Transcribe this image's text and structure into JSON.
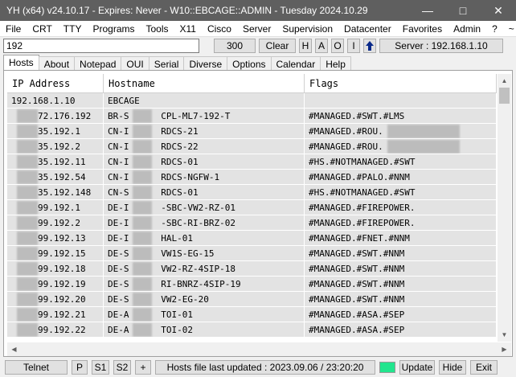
{
  "window": {
    "title": "YH (x64) v24.10.17 - Expires: Never - W10::EBCAGE::ADMIN - Tuesday 2024.10.29",
    "minimize": "—",
    "maximize": "□",
    "close": "✕"
  },
  "menu": [
    "File",
    "CRT",
    "TTY",
    "Programs",
    "Tools",
    "X11",
    "Cisco",
    "Server",
    "Supervision",
    "Datacenter",
    "Favorites",
    "Admin",
    "?",
    "~"
  ],
  "toolbar": {
    "search_value": "192",
    "count_value": "300",
    "clear": "Clear",
    "h": "H",
    "a": "A",
    "o": "O",
    "i": "I",
    "up_arrow": "🡅",
    "server": "Server : 192.168.1.10"
  },
  "tabs": [
    "Hosts",
    "About",
    "Notepad",
    "OUI",
    "Serial",
    "Diverse",
    "Options",
    "Calendar",
    "Help"
  ],
  "table": {
    "headers": [
      "IP Address",
      "Hostname",
      "Flags"
    ],
    "rows": [
      [
        "192.168.1.10",
        "EBCAGE",
        ""
      ],
      [
        "72.176.192",
        "BR-S      CPL-ML7-192-T",
        "#MANAGED.#SWT.#LMS"
      ],
      [
        "35.192.1",
        "CN-I      RDCS-21",
        "#MANAGED.#ROU."
      ],
      [
        "35.192.2",
        "CN-I      RDCS-22",
        "#MANAGED.#ROU."
      ],
      [
        "35.192.11",
        "CN-I      RDCS-01",
        "#HS.#NOTMANAGED.#SWT"
      ],
      [
        "35.192.54",
        "CN-I      RDCS-NGFW-1",
        "#MANAGED.#PALO.#NNM"
      ],
      [
        "35.192.148",
        "CN-S      RDCS-01",
        "#HS.#NOTMANAGED.#SWT"
      ],
      [
        "99.192.1",
        "DE-I      -SBC-VW2-RZ-01",
        "#MANAGED.#FIREPOWER."
      ],
      [
        "99.192.2",
        "DE-I      -SBC-RI-BRZ-02",
        "#MANAGED.#FIREPOWER."
      ],
      [
        "99.192.13",
        "DE-I      HAL-01",
        "#MANAGED.#FNET.#NNM"
      ],
      [
        "99.192.15",
        "DE-S      VW1S-EG-15",
        "#MANAGED.#SWT.#NNM"
      ],
      [
        "99.192.18",
        "DE-S      VW2-RZ-4SIP-18",
        "#MANAGED.#SWT.#NNM"
      ],
      [
        "99.192.19",
        "DE-S      RI-BNRZ-4SIP-19",
        "#MANAGED.#SWT.#NNM"
      ],
      [
        "99.192.20",
        "DE-S      VW2-EG-20",
        "#MANAGED.#SWT.#NNM"
      ],
      [
        "99.192.21",
        "DE-A      TOI-01",
        "#MANAGED.#ASA.#SEP"
      ],
      [
        "99.192.22",
        "DE-A      TOI-02",
        "#MANAGED.#ASA.#SEP"
      ]
    ]
  },
  "statusbar": {
    "telnet": "Telnet",
    "p": "P",
    "s1": "S1",
    "s2": "S2",
    "plus": "+",
    "info": "Hosts file last updated : 2023.09.06 / 23:20:20",
    "indicator_color": "#22e58e",
    "update": "Update",
    "hide": "Hide",
    "exit": "Exit"
  }
}
